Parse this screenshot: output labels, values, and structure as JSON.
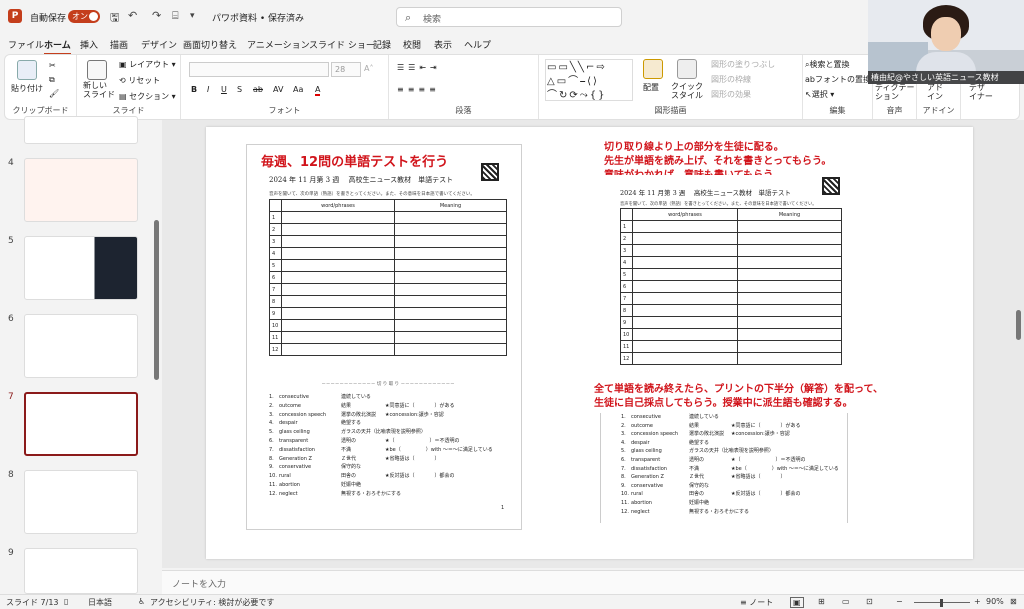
{
  "titlebar": {
    "autosave_label": "自動保存",
    "autosave_toggle": "オン",
    "file_name": "パワポ資料 • 保存済み",
    "search_placeholder": "検索"
  },
  "menu": [
    "ファイル",
    "ホーム",
    "挿入",
    "描画",
    "デザイン",
    "画面切り替え",
    "アニメーション",
    "スライド ショー",
    "記録",
    "校閲",
    "表示",
    "ヘルプ"
  ],
  "menu_active": "ホーム",
  "ribbon": {
    "clipboard": {
      "paste": "貼り付け",
      "label": "クリップボード"
    },
    "slides": {
      "new_slide": "新しい\nスライド",
      "layout": "レイアウト",
      "reset": "リセット",
      "section": "セクション",
      "label": "スライド"
    },
    "font": {
      "size": "28",
      "label": "フォント"
    },
    "paragraph": {
      "label": "段落"
    },
    "drawing": {
      "arrange": "配置",
      "quick_style": "クイック\nスタイル",
      "shape_fill": "図形の塗りつぶし",
      "shape_outline": "図形の枠線",
      "shape_effects": "図形の効果",
      "label": "図形描画"
    },
    "editing": {
      "find_replace": "検索と置換",
      "replace_font": "フォントの置換",
      "select": "選択",
      "label": "編集"
    },
    "voice": {
      "dictate": "ディクテー\nション",
      "label": "音声"
    },
    "addins": {
      "addin": "アド\nイン",
      "label": "アドイン"
    },
    "designer": {
      "label": "デザ\nイナー"
    }
  },
  "webcam": {
    "caption": "椿由紀@やさしい英語ニュース教材"
  },
  "slide_panel": {
    "numbers": [
      "4",
      "5",
      "6",
      "7",
      "8",
      "9"
    ],
    "selected": "7"
  },
  "slide": {
    "left_heading": "毎週、12問の単語テストを行う",
    "right_notes": [
      "切り取り線より上の部分を生徒に配る。",
      "先生が単語を読み上げ、それを書きとってもらう。",
      "意味がわかれば、意味も書いてもらう。"
    ],
    "right_notes2": [
      "全て単語を読み終えたら、プリントの下半分（解答）を配って、",
      "生徒に自己採点してもらう。授業中に派生語も確認する。"
    ],
    "worksheet": {
      "title": "2024 年 11 月第 3 週　 高校生ニュース教材　単語テスト",
      "instruction": "音声を聞いて、次の単語（熟語）を書きとってください。また、その意味を日本語で書いてください。",
      "col_word": "word/phrases",
      "col_meaning": "Meaning",
      "rows": [
        "1",
        "2",
        "3",
        "4",
        "5",
        "6",
        "7",
        "8",
        "9",
        "10",
        "11",
        "12"
      ],
      "cut_line": "－－－－－－－－－－－－ 切 り 取 り －－－－－－－－－－－－",
      "vocab": [
        [
          "1.",
          "consecutive",
          "連続している",
          ""
        ],
        [
          "2.",
          "outcome",
          "結果",
          "★同意語に（　　　　）がある"
        ],
        [
          "3.",
          "concession speech",
          "選挙の敗北演説",
          "★concession:譲歩・容認"
        ],
        [
          "4.",
          "despair",
          "絶望する",
          ""
        ],
        [
          "5.",
          "glass ceiling",
          "ガラスの天井（比喩表現を説明参照）",
          ""
        ],
        [
          "6.",
          "transparent",
          "透明の",
          "★（　　　　　　　）＝不透明の"
        ],
        [
          "7.",
          "dissatisfaction",
          "不満",
          "★be（　　　　　）with ～＝～に満足している"
        ],
        [
          "8.",
          "Generation Z",
          "Ｚ世代",
          "★省略語は（　　　　）"
        ],
        [
          "9.",
          "conservative",
          "保守的な",
          ""
        ],
        [
          "10.",
          "rural",
          "田舎の",
          "★反対語は（　　　　）都会の"
        ],
        [
          "11.",
          "abortion",
          "妊娠中絶",
          ""
        ],
        [
          "12.",
          "neglect",
          "無視する・おろそかにする",
          ""
        ]
      ],
      "page": "1"
    }
  },
  "notes": {
    "placeholder": "ノートを入力"
  },
  "status": {
    "slide_count": "スライド 7/13",
    "language": "日本語",
    "accessibility": "アクセシビリティ: 検討が必要です",
    "notes": "ノート",
    "zoom": "90%"
  },
  "colors": {
    "accent": "#c43e1c",
    "note_red": "#d1141b",
    "selected_thumb": "#8b1a1a"
  }
}
